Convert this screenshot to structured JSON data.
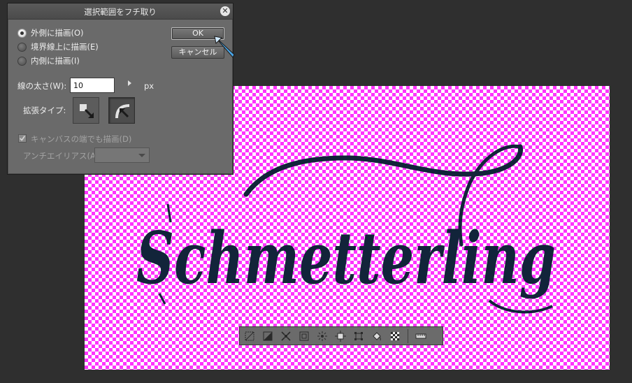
{
  "dialog": {
    "title": "選択範囲をフチ取り",
    "close_label": "✕",
    "ok_label": "OK",
    "cancel_label": "キャンセル",
    "radio_options": [
      {
        "label": "外側に描画(O)",
        "checked": true
      },
      {
        "label": "境界線上に描画(E)",
        "checked": false
      },
      {
        "label": "内側に描画(I)",
        "checked": false
      }
    ],
    "line_width_label": "線の太さ(W):",
    "line_width_value": "10",
    "line_width_unit": "px",
    "expand_type_label": "拡張タイプ:",
    "canvas_edge_label": "キャンバスの端でも描画(D)",
    "canvas_edge_checked": true,
    "antialias_label": "アンチエイリアス(A):",
    "antialias_value": ""
  },
  "canvas": {
    "text": "Schmetterling",
    "text_color": "#12243a",
    "checker_colors": [
      "#ff33ff",
      "#ffffff"
    ]
  },
  "selection_toolbar": {
    "icons": [
      "deselect-icon",
      "invert-selection-icon",
      "expand-selection-icon",
      "shrink-selection-icon",
      "select-area-icon",
      "scale-rotate-icon",
      "transform-icon",
      "fill-icon",
      "transparent-fill-icon",
      "settings-icon"
    ]
  }
}
